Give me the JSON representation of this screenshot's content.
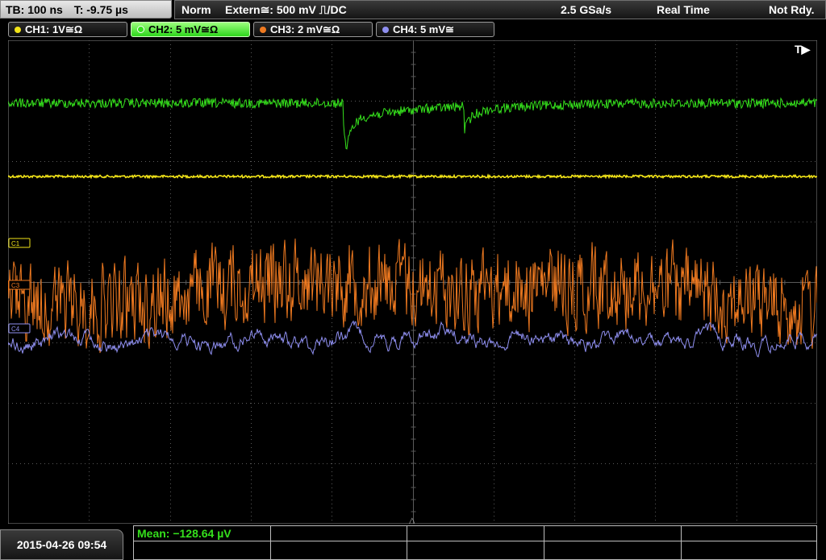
{
  "topbar": {
    "timebase": "TB: 100 ns",
    "trigger_time": "T: -9.75 µs",
    "trigger_mode": "Norm",
    "trigger_source": "Extern≅: 500 mV ⎍/DC",
    "sample_rate": "2.5 GSa/s",
    "acq_mode": "Real Time",
    "trigger_status": "Not Rdy."
  },
  "channels": [
    {
      "label": "CH1: 1V≅Ω",
      "color": "#f2e418",
      "active": false
    },
    {
      "label": "CH2: 5 mV≅Ω",
      "color": "#35e01c",
      "active": true
    },
    {
      "label": "CH3: 2 mV≅Ω",
      "color": "#f07a20",
      "active": false
    },
    {
      "label": "CH4: 5 mV≅",
      "color": "#8f8ff0",
      "active": false
    }
  ],
  "markers": {
    "trigger_marker": "T▶",
    "ch1_marker": "C1",
    "ch3_marker": "C3",
    "ch4_marker": "C4",
    "trigger_pos_marker": "△"
  },
  "timestamp": "2015-04-26 09:54",
  "measurement": {
    "mean_label": "Mean: −128.64 µV"
  },
  "colors": {
    "grid": "#5a5a5a",
    "ch1": "#f2e418",
    "ch2": "#35e01c",
    "ch3": "#f07a20",
    "ch4": "#8f8ff0"
  }
}
